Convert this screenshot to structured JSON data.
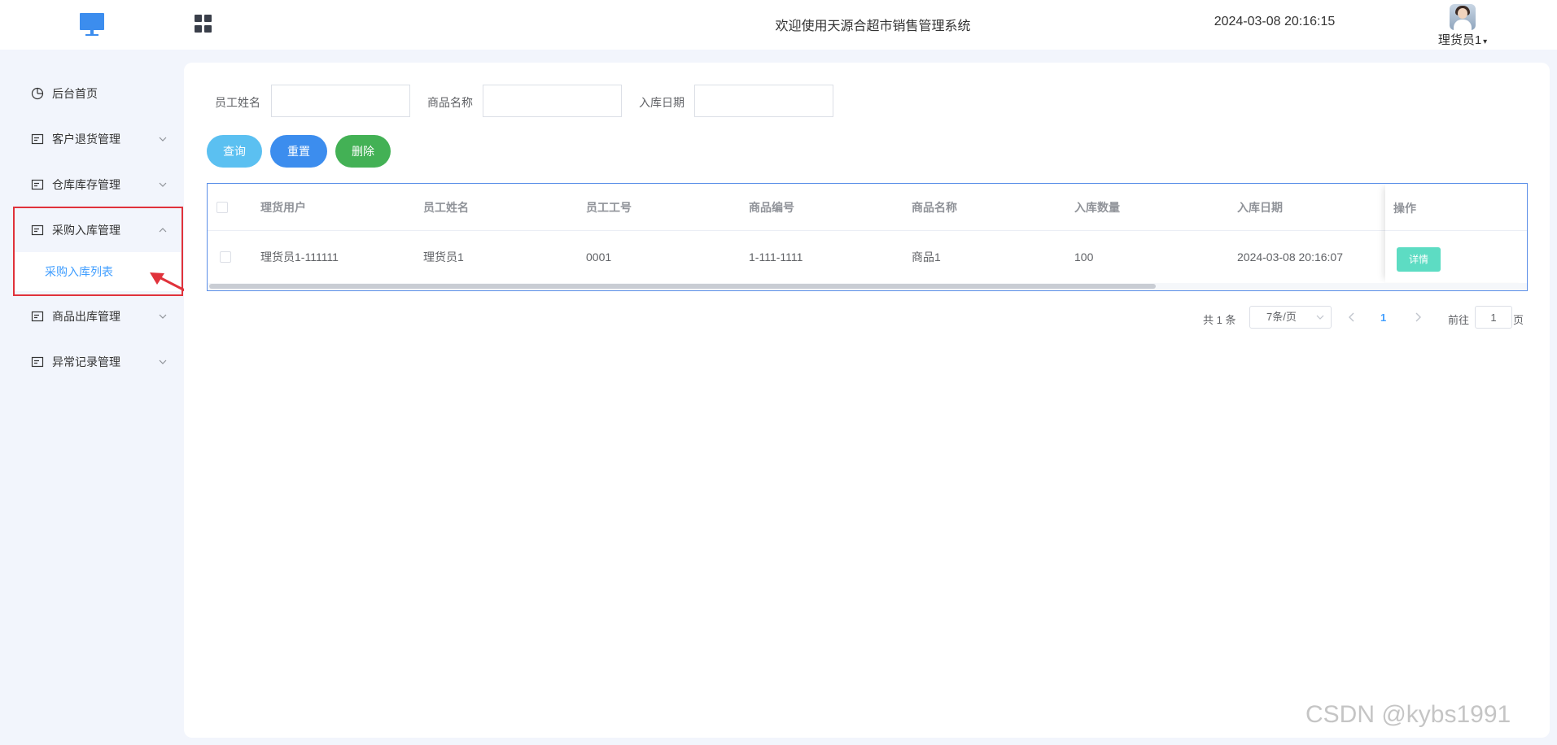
{
  "header": {
    "welcome": "欢迎使用天源合超市销售管理系统",
    "datetime": "2024-03-08 20:16:15",
    "user_name": "理货员1",
    "user_caret": "⌄"
  },
  "sidebar": {
    "items": [
      {
        "label": "后台首页",
        "icon": "dashboard-icon",
        "expanded": false,
        "has_arrow": false
      },
      {
        "label": "客户退货管理",
        "icon": "list-icon",
        "expanded": false,
        "has_arrow": true
      },
      {
        "label": "仓库库存管理",
        "icon": "list-icon",
        "expanded": false,
        "has_arrow": true
      },
      {
        "label": "采购入库管理",
        "icon": "list-icon",
        "expanded": true,
        "has_arrow": true
      },
      {
        "label": "商品出库管理",
        "icon": "list-icon",
        "expanded": false,
        "has_arrow": true
      },
      {
        "label": "异常记录管理",
        "icon": "list-icon",
        "expanded": false,
        "has_arrow": true
      }
    ],
    "submenu": {
      "label": "采购入库列表",
      "active": true
    }
  },
  "search": {
    "employee_name_label": "员工姓名",
    "employee_name_value": "",
    "product_name_label": "商品名称",
    "product_name_value": "",
    "stock_date_label": "入库日期",
    "stock_date_value": ""
  },
  "buttons": {
    "query": "查询",
    "reset": "重置",
    "delete": "删除"
  },
  "table": {
    "columns": [
      "理货用户",
      "员工姓名",
      "员工工号",
      "商品编号",
      "商品名称",
      "入库数量",
      "入库日期"
    ],
    "action_column": "操作",
    "rows": [
      {
        "cells": [
          "理货员1-111111",
          "理货员1",
          "0001",
          "1-111-1111",
          "商品1",
          "100",
          "2024-03-08 20:16:07"
        ],
        "action_label": "详情"
      }
    ]
  },
  "pagination": {
    "total": "共 1 条",
    "page_size": "7条/页",
    "current_page": "1",
    "goto_label": "前往",
    "goto_value": "1",
    "page_suffix": "页"
  },
  "watermark": "CSDN @kybs1991",
  "colors": {
    "accent": "#409eff",
    "query_button": "#5bc0f1",
    "reset_button": "#3c8dee",
    "delete_button": "#43b155",
    "detail_button": "#5ddcc3",
    "highlight": "#e0323b"
  }
}
